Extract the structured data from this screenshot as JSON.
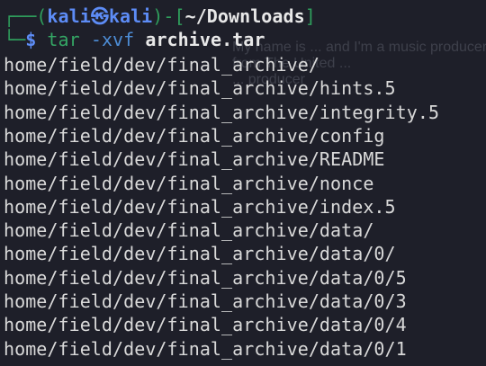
{
  "background_color": "#1e1f29",
  "prompt": {
    "corner_top": "┌──(",
    "corner_bottom": "└─",
    "username": "kali",
    "at_glyph": "㉿",
    "hostname": "kali",
    "close_paren": ")-[",
    "cwd": "~/Downloads",
    "close_bracket": "]",
    "symbol": "$"
  },
  "command": {
    "program": "tar",
    "flags": "-xvf",
    "argument": "archive.tar"
  },
  "overlay_text": "My name is ... and I'm a music producer from The United ...\n... producer",
  "output_lines": [
    "home/field/dev/final_archive/",
    "home/field/dev/final_archive/hints.5",
    "home/field/dev/final_archive/integrity.5",
    "home/field/dev/final_archive/config",
    "home/field/dev/final_archive/README",
    "home/field/dev/final_archive/nonce",
    "home/field/dev/final_archive/index.5",
    "home/field/dev/final_archive/data/",
    "home/field/dev/final_archive/data/0/",
    "home/field/dev/final_archive/data/0/5",
    "home/field/dev/final_archive/data/0/3",
    "home/field/dev/final_archive/data/0/4",
    "home/field/dev/final_archive/data/0/1"
  ]
}
